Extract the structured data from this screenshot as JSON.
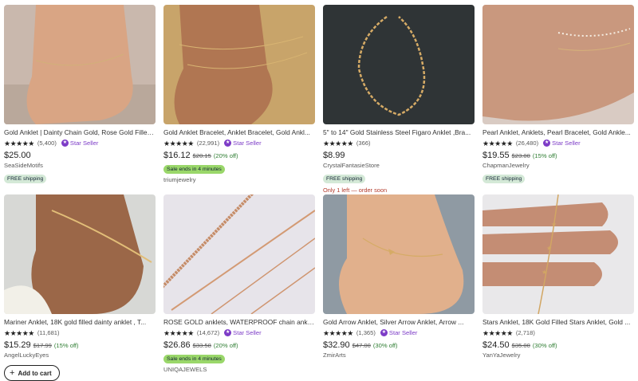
{
  "products": [
    {
      "title": "Gold Anklet | Dainty Chain Gold, Rose Gold Filled...",
      "stars": "★★★★★",
      "count": "(5,400)",
      "star_seller": "Star Seller",
      "price": "$25.00",
      "old_price": "",
      "discount": "",
      "sale": "",
      "shop": "SeaSideMotifs",
      "free_shipping": "FREE shipping",
      "urgency": ""
    },
    {
      "title": "Gold Anklet Bracelet, Anklet Bracelet, Gold Ankl...",
      "stars": "★★★★★",
      "count": "(22,991)",
      "star_seller": "Star Seller",
      "price": "$16.12",
      "old_price": "$20.15",
      "discount": "(20% off)",
      "sale": "Sale ends in 4 minutes",
      "shop": "triumjewelry",
      "free_shipping": "",
      "urgency": ""
    },
    {
      "title": "5\" to 14\" Gold Stainless Steel Figaro Anklet ,Bra...",
      "stars": "★★★★★",
      "count": "(366)",
      "star_seller": "",
      "price": "$8.99",
      "old_price": "",
      "discount": "",
      "sale": "",
      "shop": "CrystalFantasieStore",
      "free_shipping": "FREE shipping",
      "urgency": "Only 1 left — order soon"
    },
    {
      "title": "Pearl Anklet, Anklets, Pearl Bracelet, Gold Ankle...",
      "stars": "★★★★★",
      "count": "(26,480)",
      "star_seller": "Star Seller",
      "price": "$19.55",
      "old_price": "$23.00",
      "discount": "(15% off)",
      "sale": "",
      "shop": "ChapmanJewelry",
      "free_shipping": "FREE shipping",
      "urgency": ""
    },
    {
      "title": "Mariner Anklet, 18K gold filled dainty anklet , T...",
      "stars": "★★★★★",
      "count": "(11,681)",
      "star_seller": "",
      "price": "$15.29",
      "old_price": "$17.99",
      "discount": "(15% off)",
      "sale": "",
      "shop": "AngelLuckyEyes",
      "free_shipping": "",
      "urgency": "",
      "add_to_cart": "Add to cart"
    },
    {
      "title": "ROSE GOLD anklets, WATERPROOF chain ankle...",
      "stars": "★★★★★",
      "count": "(14,672)",
      "star_seller": "Star Seller",
      "price": "$26.86",
      "old_price": "$33.58",
      "discount": "(20% off)",
      "sale": "Sale ends in 4 minutes",
      "shop": "UNIQAJEWELS",
      "free_shipping": "",
      "urgency": ""
    },
    {
      "title": "Gold Arrow Anklet, Silver Arrow Anklet, Arrow ...",
      "stars": "★★★★★",
      "count": "(1,365)",
      "star_seller": "Star Seller",
      "price": "$32.90",
      "old_price": "$47.00",
      "discount": "(30% off)",
      "sale": "",
      "shop": "ZmirArts",
      "free_shipping": "",
      "urgency": ""
    },
    {
      "title": "Stars Anklet, 18K Gold Filled Stars Anklet, Gold ...",
      "stars": "★★★★★",
      "count": "(2,718)",
      "star_seller": "",
      "price": "$24.50",
      "old_price": "$35.00",
      "discount": "(30% off)",
      "sale": "",
      "shop": "YanYaJewelry",
      "free_shipping": "",
      "urgency": ""
    }
  ],
  "icons": {
    "star_badge": "star-seller-badge-icon",
    "plus": "plus-icon"
  },
  "colors": {
    "star_seller": "#7d3cc7",
    "discount": "#2e7d32",
    "sale_pill": "#9ad76a",
    "free_ship_pill": "#d4e9d7",
    "urgency": "#b23a2b"
  }
}
